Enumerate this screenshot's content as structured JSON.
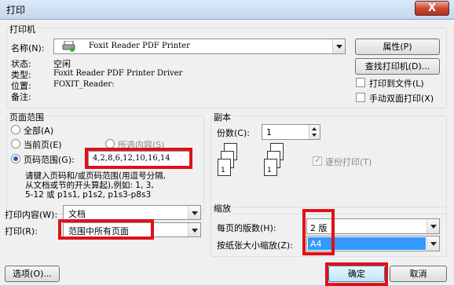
{
  "window": {
    "title": "打印",
    "close_label": "X"
  },
  "printer": {
    "group_label": "打印机",
    "name_label": "名称(N):",
    "name_value": "Foxit Reader PDF Printer",
    "status_label": "状态:",
    "status_value": "空闲",
    "type_label": "类型:",
    "type_value": "Foxit Reader PDF Printer Driver",
    "location_label": "位置:",
    "location_value": "FOXIT_Reader:",
    "comment_label": "备注:",
    "properties_button": "属性(P)",
    "find_printer_button": "查找打印机(D)...",
    "print_to_file_label": "打印到文件(L)",
    "manual_duplex_label": "手动双面打印(X)"
  },
  "page_range": {
    "group_label": "页面范围",
    "all_label": "全部(A)",
    "current_label": "当前页(E)",
    "selection_label": "所选内容(S)",
    "pages_label": "页码范围(G):",
    "pages_value": "4,2,8,6,12,10,16,14",
    "hint_line1": "请键入页码和/或页码范围(用逗号分隔,",
    "hint_line2": "从文档或节的开头算起),例如: 1, 3,",
    "hint_line3": "5-12 或 p1s1, p1s2, p1s3-p8s3"
  },
  "copies": {
    "group_label": "副本",
    "count_label": "份数(C):",
    "count_value": "1",
    "collate_label": "逐份打印(T)",
    "page_numbers": [
      "1",
      "2",
      "3"
    ]
  },
  "print_options": {
    "print_what_label": "打印内容(W):",
    "print_what_value": "文档",
    "print_label": "打印(R):",
    "print_value": "范围中所有页面"
  },
  "zoom": {
    "group_label": "缩放",
    "pages_per_sheet_label": "每页的版数(H):",
    "pages_per_sheet_value": "2 版",
    "scale_label": "按纸张大小缩放(Z):",
    "scale_value": "A4"
  },
  "footer": {
    "options_button": "选项(O)...",
    "ok_button": "确定",
    "cancel_button": "取消"
  },
  "colors": {
    "highlight": "#e0101a",
    "selection": "#3399ff"
  }
}
